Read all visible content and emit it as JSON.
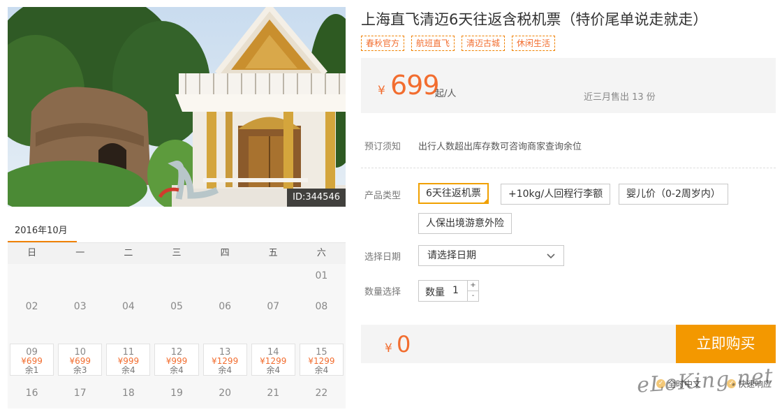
{
  "photo": {
    "id_label": "ID:344546"
  },
  "calendar": {
    "month_tab": "2016年10月",
    "weekdays": [
      "日",
      "一",
      "二",
      "三",
      "四",
      "五",
      "六"
    ],
    "rows": [
      [
        null,
        null,
        null,
        null,
        null,
        null,
        {
          "day": "01"
        }
      ],
      [
        {
          "day": "02"
        },
        {
          "day": "03"
        },
        {
          "day": "04"
        },
        {
          "day": "05"
        },
        {
          "day": "06"
        },
        {
          "day": "07"
        },
        {
          "day": "08"
        }
      ],
      [
        {
          "day": "09",
          "price": "¥699",
          "stock": "余1"
        },
        {
          "day": "10",
          "price": "¥699",
          "stock": "余3"
        },
        {
          "day": "11",
          "price": "¥999",
          "stock": "余4"
        },
        {
          "day": "12",
          "price": "¥999",
          "stock": "余4"
        },
        {
          "day": "13",
          "price": "¥1299",
          "stock": "余4"
        },
        {
          "day": "14",
          "price": "¥1299",
          "stock": "余4"
        },
        {
          "day": "15",
          "price": "¥1299",
          "stock": "余4"
        }
      ],
      [
        {
          "day": "16"
        },
        {
          "day": "17"
        },
        {
          "day": "18"
        },
        {
          "day": "19"
        },
        {
          "day": "20"
        },
        {
          "day": "21"
        },
        {
          "day": "22"
        }
      ]
    ]
  },
  "product": {
    "title": "上海直飞清迈6天往返含税机票（特价尾单说走就走）",
    "tags": [
      "春秋官方",
      "航班直飞",
      "清迈古城",
      "休闲生活"
    ],
    "price": {
      "currency": "¥",
      "amount": "699",
      "unit": "起/人",
      "sold_text": "近三月售出 13 份"
    }
  },
  "form": {
    "notice_label": "预订须知",
    "notice_text": "出行人数超出库存数可咨询商家查询余位",
    "type_label": "产品类型",
    "type_options": [
      "6天往返机票",
      "+10kg/人回程行李额",
      "婴儿价（0-2周岁内）",
      "人保出境游意外险"
    ],
    "date_label": "选择日期",
    "date_placeholder": "请选择日期",
    "qty_label": "数量选择",
    "qty_inner_label": "数量",
    "qty_value": "1",
    "qty_plus": "+",
    "qty_minus": "-"
  },
  "checkout": {
    "currency": "¥",
    "total": "0",
    "buy_label": "立即购买",
    "promises": [
      "全时中文",
      "快速响应"
    ]
  },
  "watermark": "eLoKing.net",
  "colors": {
    "accent": "#f26d2f",
    "button": "#f39800",
    "selected_border": "#f0a000"
  }
}
